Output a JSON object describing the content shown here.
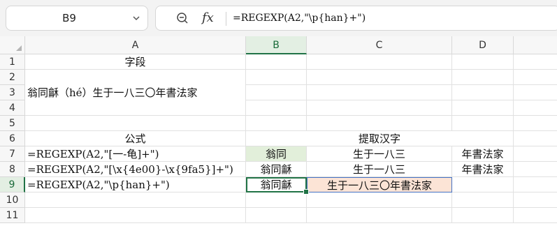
{
  "namebox": {
    "value": "B9"
  },
  "formula_bar": {
    "text": "=REGEXP(A2,\"\\p{han}+\")"
  },
  "columns": [
    "A",
    "B",
    "C",
    "D"
  ],
  "rows": [
    "1",
    "2",
    "3",
    "4",
    "5",
    "6",
    "7",
    "8",
    "9",
    "10",
    "11"
  ],
  "cells": {
    "A1": "字段",
    "A3": "翁同龢（hé）生于一八三〇年書法家",
    "A6": "公式",
    "BC6": "提取汉字",
    "A7": "=REGEXP(A2,\"[一-龟]+\")",
    "B7": "翁同",
    "C7": "生于一八三",
    "D7": "年書法家",
    "A8": "=REGEXP(A2,\"[\\x{4e00}-\\x{9fa5}]+\")",
    "B8": "翁同龢",
    "C8": "生于一八三",
    "D8": "年書法家",
    "A9": "=REGEXP(A2,\"\\p{han}+\")",
    "B9": "翁同龢",
    "C9": "生于一八三〇年書法家"
  },
  "colors": {
    "selection": "#217346",
    "green_fill": "#e2efda",
    "orange_fill": "#fce4d6"
  },
  "icons": {
    "zoom": "zoom-icon",
    "function": "fx-icon",
    "dropdown": "chevron-down-icon"
  }
}
